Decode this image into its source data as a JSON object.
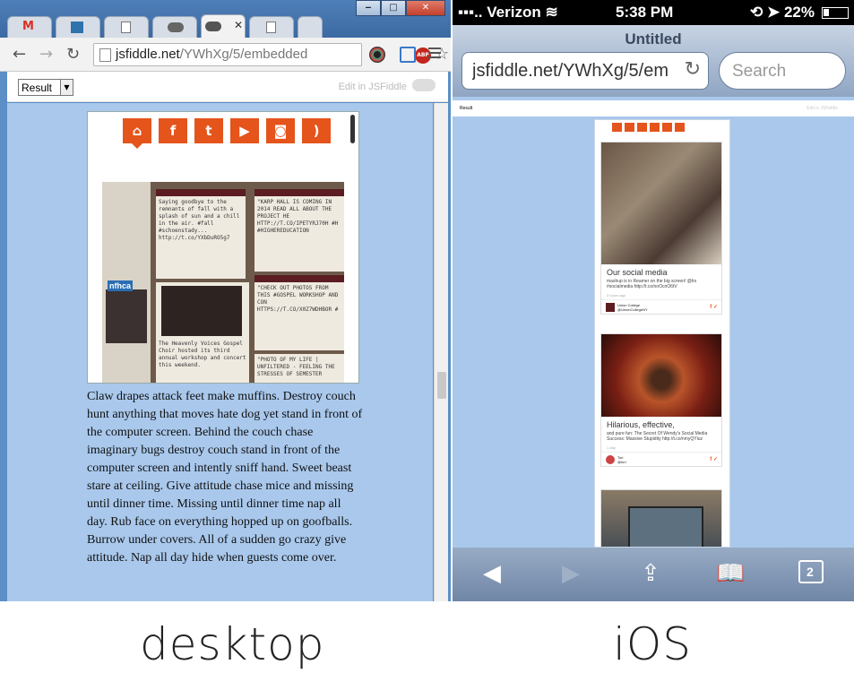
{
  "desktop": {
    "browser": {
      "url_host": "jsfiddle.net",
      "url_path": "/YWhXg/5/embedded",
      "abp_label": "ABP"
    },
    "fiddle": {
      "result_select": "Result",
      "edit_link": "Edit in JSFiddle"
    },
    "social_icons": [
      "home-icon",
      "facebook-icon",
      "twitter-icon",
      "youtube-icon",
      "instagram-icon",
      "rss-icon"
    ],
    "photo_card_texts": [
      "Saying goodbye to the remnants of fall with a splash of sun and a chill in the air. #fall #schoenstady... http://t.co/YXbDuRO5g7",
      "\"KARP HALL IS COMING IN 2014 READ ALL ABOUT THE PROJECT HE HTTP://T.CO/IPETYRJ70H #H #HIGHEREDUCATION",
      "\"CHECK OUT PHOTOS FROM THIS #GOSPEL WORKSHOP AND CON HTTPS://T.CO/X0Z7WDHBOR #",
      "The Heavenly Voices Gospel Choir hosted its third annual workshop and concert this weekend.",
      "\"PHOTO OF MY LIFE | UNFILTERED - FEELING THE STRESSES OF SEMESTER",
      "nfhca"
    ],
    "body_text": "Claw drapes attack feet make muffins. Destroy couch hunt anything that moves hate dog yet stand in front of the computer screen. Behind the couch chase imaginary bugs destroy couch stand in front of the computer screen and intently sniff hand. Sweet beast stare at ceiling. Give attitude chase mice and missing until dinner time. Missing until dinner time nap all day. Rub face on everything hopped up on goofballs. Burrow under covers. All of a sudden go crazy give attitude. Nap all day hide when guests come over."
  },
  "ios": {
    "status": {
      "carrier": "Verizon",
      "time": "5:38 PM",
      "battery": "22%"
    },
    "title": "Untitled",
    "url": "jsfiddle.net/YWhXg/5/em",
    "search_placeholder": "Search",
    "result_label": "Result",
    "edit_label": "Edit in JSFiddle",
    "cards": [
      {
        "title": "Our social media",
        "text": "mashup is in Reamer on the big screen! @lrs #socialmedia http://t.co/noOcnO6tV",
        "meta": "2 hours ago",
        "author": "Union College",
        "handle": "@UnionCollegeNY"
      },
      {
        "title": "Hilarious, effective,",
        "text": "and pure fun: The Secret Of Wendy's Social Media Success: Massive Stupidity http://t.co/nmyQYluz",
        "meta": "1 day",
        "author": "Tori",
        "handle": "@tori"
      }
    ],
    "tab_count": "2"
  },
  "captions": {
    "desktop": "desktop",
    "ios": "iOS"
  },
  "colors": {
    "social_orange": "#e4541b",
    "page_background": "#a9c8ec",
    "ios_toolbar": "#6f86a6"
  }
}
